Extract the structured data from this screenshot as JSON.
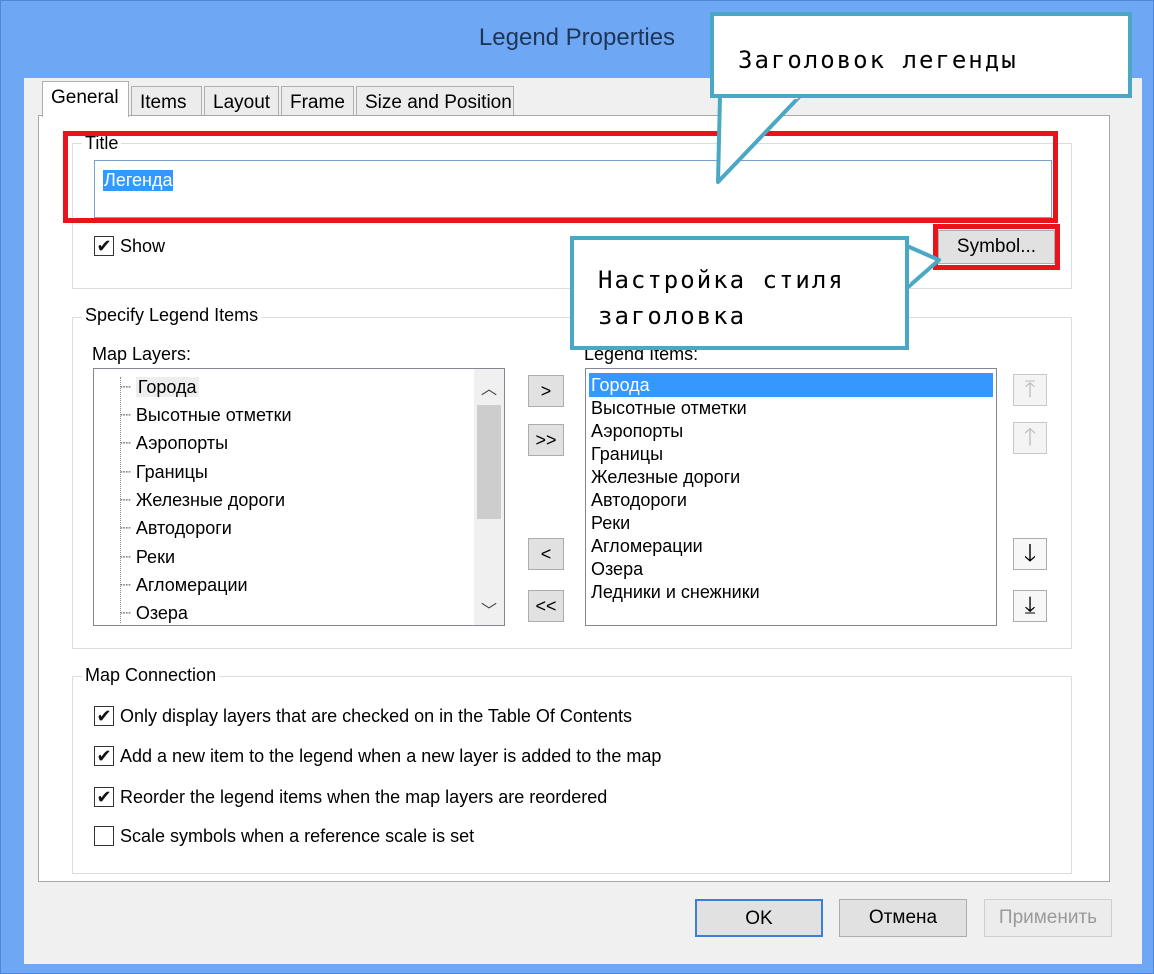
{
  "window": {
    "title": "Legend Properties"
  },
  "tabs": [
    "General",
    "Items",
    "Layout",
    "Frame",
    "Size and Position"
  ],
  "title_group": {
    "label": "Title",
    "value": "Легенда",
    "show_label": "Show",
    "show_checked": true,
    "symbol_button": "Symbol..."
  },
  "items_group": {
    "label": "Specify Legend Items",
    "map_layers_label": "Map Layers:",
    "legend_items_label": "Legend Items:",
    "map_layers": [
      "Города",
      "Высотные отметки",
      "Аэропорты",
      "Границы",
      "Железные дороги",
      "Автодороги",
      "Реки",
      "Агломерации",
      "Озера"
    ],
    "legend_items": [
      "Города",
      "Высотные отметки",
      "Аэропорты",
      "Границы",
      "Железные дороги",
      "Автодороги",
      "Реки",
      "Агломерации",
      "Озера",
      "Ледники и снежники"
    ],
    "move_buttons": {
      "add": ">",
      "add_all": ">>",
      "remove": "<",
      "remove_all": "<<"
    }
  },
  "connection_group": {
    "label": "Map Connection",
    "options": [
      {
        "label": "Only display layers that are checked on in the Table Of Contents",
        "checked": true
      },
      {
        "label": "Add a new item to the legend when a new layer is added to the map",
        "checked": true
      },
      {
        "label": "Reorder the legend items when the map layers are reordered",
        "checked": true
      },
      {
        "label": "Scale symbols when a reference scale is set",
        "checked": false
      }
    ]
  },
  "footer": {
    "ok": "OK",
    "cancel": "Отмена",
    "apply": "Применить"
  },
  "callouts": {
    "title_callout": "Заголовок легенды",
    "symbol_callout": "Настройка стиля заголовка"
  },
  "colors": {
    "window_frame": "#6ea7f4",
    "highlight": "#e8141c",
    "callout_border": "#4ba8c4",
    "selection": "#3399ff"
  }
}
